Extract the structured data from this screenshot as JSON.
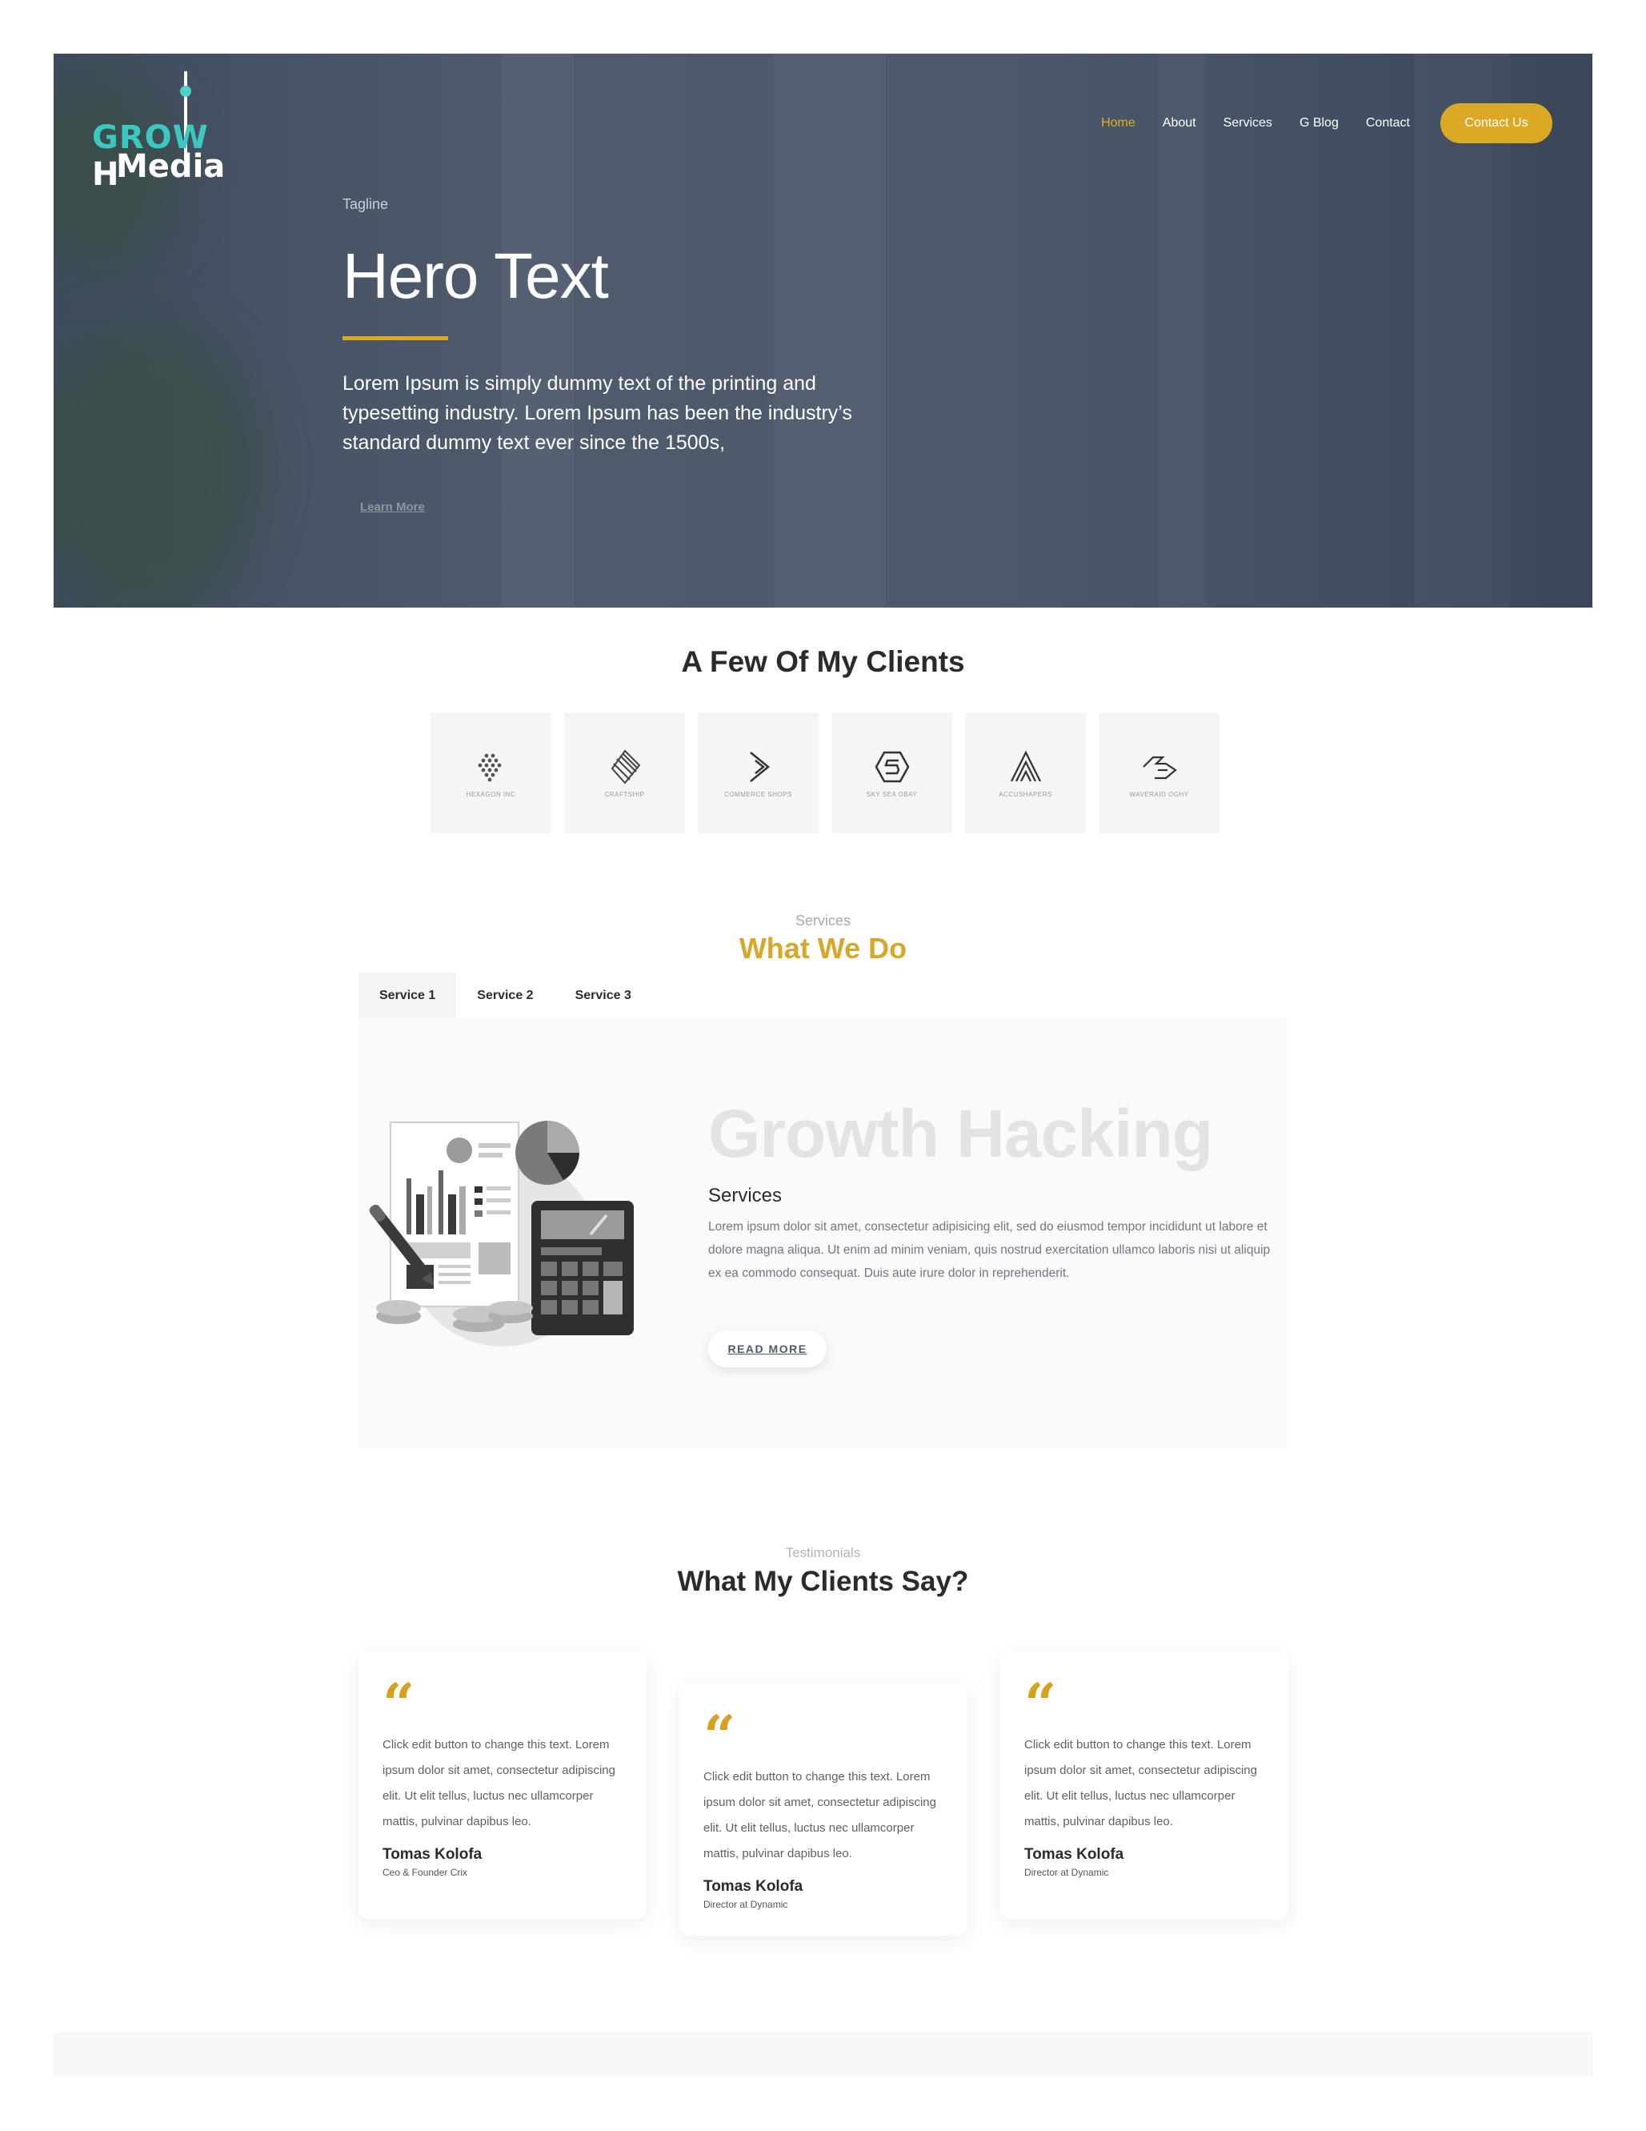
{
  "brand": {
    "logo_line1_part1": "GROW",
    "logo_line1_part2": "H",
    "logo_line2": "Media",
    "accent_color": "#dba924",
    "logo_color": "#3cc8c0"
  },
  "nav": {
    "items": [
      {
        "label": "Home",
        "active": true
      },
      {
        "label": "About",
        "active": false
      },
      {
        "label": "Services",
        "active": false
      },
      {
        "label": "G Blog",
        "active": false
      },
      {
        "label": "Contact",
        "active": false
      }
    ],
    "cta_label": "Contact Us"
  },
  "hero": {
    "tagline": "Tagline",
    "title": "Hero Text",
    "description": "Lorem Ipsum is simply dummy text of the printing and typesetting industry. Lorem Ipsum has been the industry’s standard dummy text ever since the 1500s,",
    "button_label": "Learn More"
  },
  "clients": {
    "title": "A Few Of My Clients",
    "logos": [
      {
        "icon": "dots-hexagon-icon",
        "name": "HEXAGON INC"
      },
      {
        "icon": "striped-diamond-icon",
        "name": "CRAFTSHIP"
      },
      {
        "icon": "arrow-chevron-icon",
        "name": "COMMERCE SHOPS"
      },
      {
        "icon": "s-hexagon-icon",
        "name": "SKY SEA OBAY"
      },
      {
        "icon": "triangle-peaks-icon",
        "name": "ACCUSHAPERS"
      },
      {
        "icon": "folded-arrows-icon",
        "name": "WAVERAID OGHY"
      }
    ]
  },
  "services": {
    "eyebrow": "Services",
    "title": "What We Do",
    "tabs": [
      {
        "label": "Service 1",
        "active": true
      },
      {
        "label": "Service 2",
        "active": false
      },
      {
        "label": "Service 3",
        "active": false
      }
    ],
    "panel": {
      "big_title": "Growth Hacking",
      "subtitle": "Services",
      "text": "Lorem ipsum dolor sit amet, consectetur adipisicing elit, sed do eiusmod tempor incididunt ut labore et dolore magna aliqua. Ut enim ad minim veniam, quis nostrud exercitation ullamco laboris nisi ut aliquip ex ea commodo consequat. Duis aute irure dolor in reprehenderit.",
      "button_label": "READ MORE"
    }
  },
  "testimonials": {
    "eyebrow": "Testimonials",
    "title": "What My Clients Say?",
    "cards": [
      {
        "text": "Click edit button to change this text. Lorem ipsum dolor sit amet, consectetur adipiscing elit. Ut elit tellus, luctus nec ullamcorper mattis, pulvinar dapibus leo.",
        "name": "Tomas Kolofa",
        "role": "Ceo & Founder Crix"
      },
      {
        "text": "Click edit button to change this text. Lorem ipsum dolor sit amet, consectetur adipiscing elit. Ut elit tellus, luctus nec ullamcorper mattis, pulvinar dapibus leo.",
        "name": "Tomas Kolofa",
        "role": "Director at Dynamic"
      },
      {
        "text": "Click edit button to change this text. Lorem ipsum dolor sit amet, consectetur adipiscing elit. Ut elit tellus, luctus nec ullamcorper mattis, pulvinar dapibus leo.",
        "name": "Tomas Kolofa",
        "role": "Director at Dynamic"
      }
    ]
  }
}
